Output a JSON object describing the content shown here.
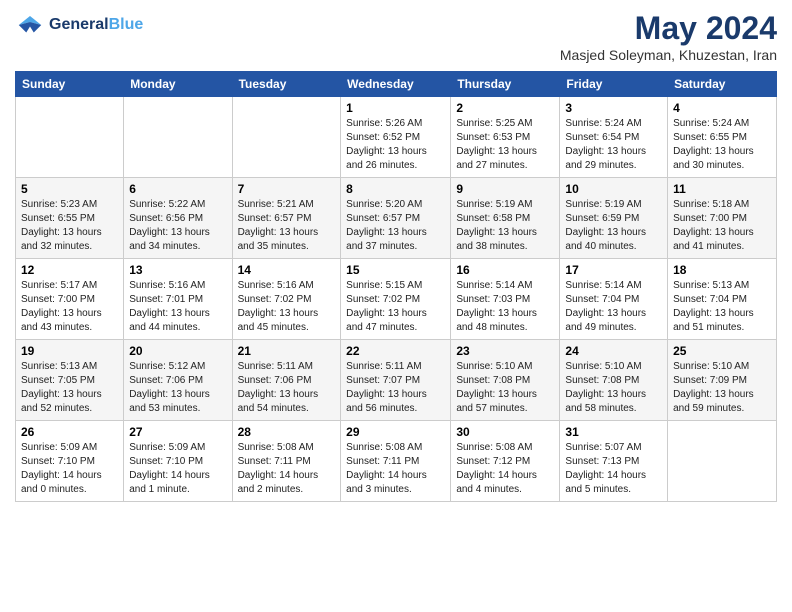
{
  "header": {
    "logo_general": "General",
    "logo_blue": "Blue",
    "month_title": "May 2024",
    "subtitle": "Masjed Soleyman, Khuzestan, Iran"
  },
  "calendar": {
    "days_of_week": [
      "Sunday",
      "Monday",
      "Tuesday",
      "Wednesday",
      "Thursday",
      "Friday",
      "Saturday"
    ],
    "weeks": [
      {
        "days": [
          {
            "number": "",
            "info": ""
          },
          {
            "number": "",
            "info": ""
          },
          {
            "number": "",
            "info": ""
          },
          {
            "number": "1",
            "info": "Sunrise: 5:26 AM\nSunset: 6:52 PM\nDaylight: 13 hours\nand 26 minutes."
          },
          {
            "number": "2",
            "info": "Sunrise: 5:25 AM\nSunset: 6:53 PM\nDaylight: 13 hours\nand 27 minutes."
          },
          {
            "number": "3",
            "info": "Sunrise: 5:24 AM\nSunset: 6:54 PM\nDaylight: 13 hours\nand 29 minutes."
          },
          {
            "number": "4",
            "info": "Sunrise: 5:24 AM\nSunset: 6:55 PM\nDaylight: 13 hours\nand 30 minutes."
          }
        ]
      },
      {
        "days": [
          {
            "number": "5",
            "info": "Sunrise: 5:23 AM\nSunset: 6:55 PM\nDaylight: 13 hours\nand 32 minutes."
          },
          {
            "number": "6",
            "info": "Sunrise: 5:22 AM\nSunset: 6:56 PM\nDaylight: 13 hours\nand 34 minutes."
          },
          {
            "number": "7",
            "info": "Sunrise: 5:21 AM\nSunset: 6:57 PM\nDaylight: 13 hours\nand 35 minutes."
          },
          {
            "number": "8",
            "info": "Sunrise: 5:20 AM\nSunset: 6:57 PM\nDaylight: 13 hours\nand 37 minutes."
          },
          {
            "number": "9",
            "info": "Sunrise: 5:19 AM\nSunset: 6:58 PM\nDaylight: 13 hours\nand 38 minutes."
          },
          {
            "number": "10",
            "info": "Sunrise: 5:19 AM\nSunset: 6:59 PM\nDaylight: 13 hours\nand 40 minutes."
          },
          {
            "number": "11",
            "info": "Sunrise: 5:18 AM\nSunset: 7:00 PM\nDaylight: 13 hours\nand 41 minutes."
          }
        ]
      },
      {
        "days": [
          {
            "number": "12",
            "info": "Sunrise: 5:17 AM\nSunset: 7:00 PM\nDaylight: 13 hours\nand 43 minutes."
          },
          {
            "number": "13",
            "info": "Sunrise: 5:16 AM\nSunset: 7:01 PM\nDaylight: 13 hours\nand 44 minutes."
          },
          {
            "number": "14",
            "info": "Sunrise: 5:16 AM\nSunset: 7:02 PM\nDaylight: 13 hours\nand 45 minutes."
          },
          {
            "number": "15",
            "info": "Sunrise: 5:15 AM\nSunset: 7:02 PM\nDaylight: 13 hours\nand 47 minutes."
          },
          {
            "number": "16",
            "info": "Sunrise: 5:14 AM\nSunset: 7:03 PM\nDaylight: 13 hours\nand 48 minutes."
          },
          {
            "number": "17",
            "info": "Sunrise: 5:14 AM\nSunset: 7:04 PM\nDaylight: 13 hours\nand 49 minutes."
          },
          {
            "number": "18",
            "info": "Sunrise: 5:13 AM\nSunset: 7:04 PM\nDaylight: 13 hours\nand 51 minutes."
          }
        ]
      },
      {
        "days": [
          {
            "number": "19",
            "info": "Sunrise: 5:13 AM\nSunset: 7:05 PM\nDaylight: 13 hours\nand 52 minutes."
          },
          {
            "number": "20",
            "info": "Sunrise: 5:12 AM\nSunset: 7:06 PM\nDaylight: 13 hours\nand 53 minutes."
          },
          {
            "number": "21",
            "info": "Sunrise: 5:11 AM\nSunset: 7:06 PM\nDaylight: 13 hours\nand 54 minutes."
          },
          {
            "number": "22",
            "info": "Sunrise: 5:11 AM\nSunset: 7:07 PM\nDaylight: 13 hours\nand 56 minutes."
          },
          {
            "number": "23",
            "info": "Sunrise: 5:10 AM\nSunset: 7:08 PM\nDaylight: 13 hours\nand 57 minutes."
          },
          {
            "number": "24",
            "info": "Sunrise: 5:10 AM\nSunset: 7:08 PM\nDaylight: 13 hours\nand 58 minutes."
          },
          {
            "number": "25",
            "info": "Sunrise: 5:10 AM\nSunset: 7:09 PM\nDaylight: 13 hours\nand 59 minutes."
          }
        ]
      },
      {
        "days": [
          {
            "number": "26",
            "info": "Sunrise: 5:09 AM\nSunset: 7:10 PM\nDaylight: 14 hours\nand 0 minutes."
          },
          {
            "number": "27",
            "info": "Sunrise: 5:09 AM\nSunset: 7:10 PM\nDaylight: 14 hours\nand 1 minute."
          },
          {
            "number": "28",
            "info": "Sunrise: 5:08 AM\nSunset: 7:11 PM\nDaylight: 14 hours\nand 2 minutes."
          },
          {
            "number": "29",
            "info": "Sunrise: 5:08 AM\nSunset: 7:11 PM\nDaylight: 14 hours\nand 3 minutes."
          },
          {
            "number": "30",
            "info": "Sunrise: 5:08 AM\nSunset: 7:12 PM\nDaylight: 14 hours\nand 4 minutes."
          },
          {
            "number": "31",
            "info": "Sunrise: 5:07 AM\nSunset: 7:13 PM\nDaylight: 14 hours\nand 5 minutes."
          },
          {
            "number": "",
            "info": ""
          }
        ]
      }
    ]
  }
}
